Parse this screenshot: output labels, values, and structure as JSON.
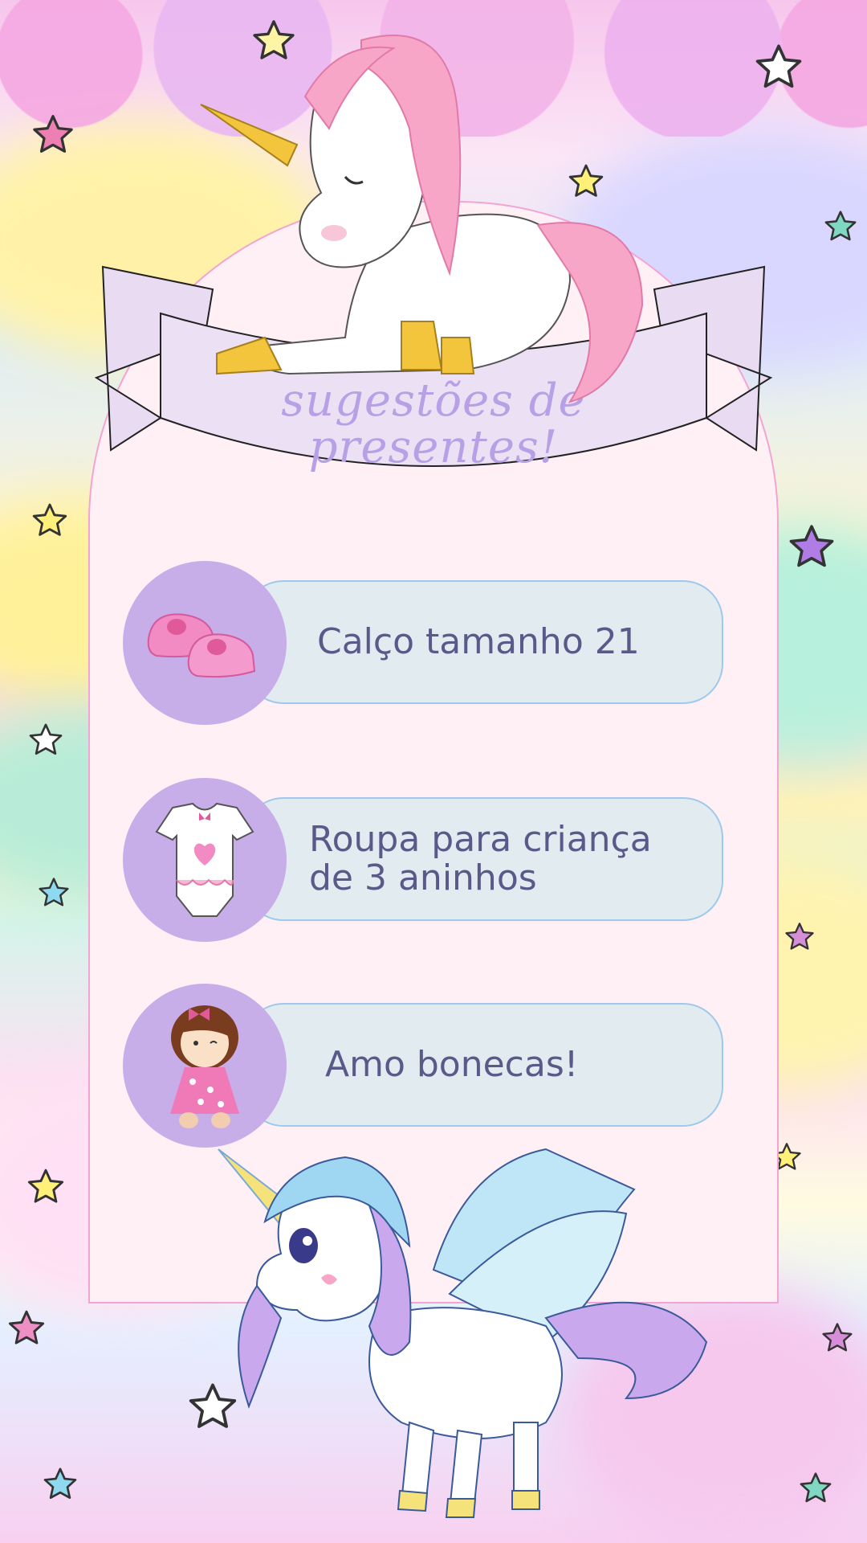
{
  "page": {
    "title_line_1": "sugestões de",
    "title_line_2": "presentes!"
  },
  "gifts": [
    {
      "label": "Calço tamanho 21",
      "icon": "baby-shoes-icon"
    },
    {
      "label_line_1": "Roupa para criança",
      "label_line_2": "de 3 aninhos",
      "icon": "baby-bodysuit-icon"
    },
    {
      "label": "Amo bonecas!",
      "icon": "doll-icon"
    }
  ],
  "colors": {
    "card_bg": "#fff0f6",
    "card_border": "#f3a4d2",
    "circle": "#c7aee9",
    "pill": "#e2ecf0",
    "pill_border": "#9ec9ec",
    "text": "#5a5a8a",
    "title": "#b8a0e6",
    "banner": "#ece0f4"
  }
}
